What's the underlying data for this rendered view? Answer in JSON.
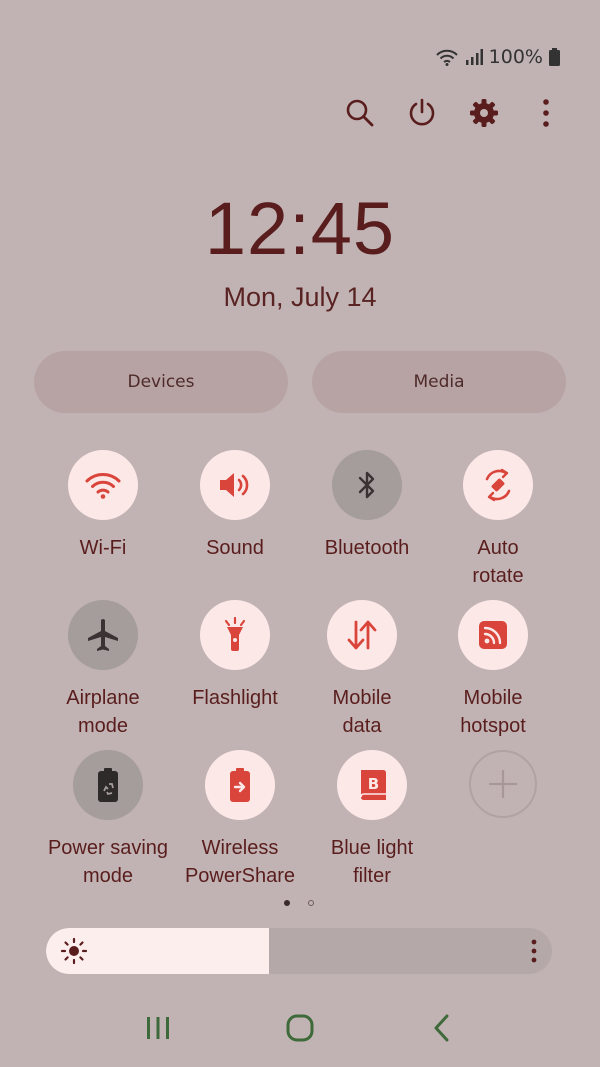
{
  "status": {
    "battery_text": "100%",
    "icons": [
      "wifi-icon",
      "signal-icon",
      "battery-icon"
    ]
  },
  "top_actions": [
    "search-icon",
    "power-icon",
    "settings-icon",
    "more-icon"
  ],
  "clock": {
    "time": "12:45",
    "date": "Mon, July 14"
  },
  "pills": {
    "devices": "Devices",
    "media": "Media"
  },
  "tiles": {
    "wifi": {
      "label": "Wi-Fi",
      "on": true
    },
    "sound": {
      "label": "Sound",
      "on": true
    },
    "bluetooth": {
      "label": "Bluetooth",
      "on": false
    },
    "auto_rotate": {
      "label_1": "Auto",
      "label_2": "rotate",
      "on": true
    },
    "airplane": {
      "label_1": "Airplane",
      "label_2": "mode",
      "on": false
    },
    "flashlight": {
      "label": "Flashlight",
      "on": true
    },
    "mobile_data": {
      "label_1": "Mobile",
      "label_2": "data",
      "on": true
    },
    "hotspot": {
      "label_1": "Mobile",
      "label_2": "hotspot",
      "on": true
    },
    "power_saving": {
      "label_1": "Power saving",
      "label_2": "mode",
      "on": false
    },
    "powershare": {
      "label_1": "Wireless",
      "label_2": "PowerShare",
      "on": true
    },
    "blue_light": {
      "label_1": "Blue light",
      "label_2": "filter",
      "on": true
    }
  },
  "pager": {
    "pages": 2,
    "current": 1
  },
  "brightness": {
    "level": 0.44
  },
  "colors": {
    "background": "#c1b3b3",
    "accent": "#d9443b",
    "tile_on": "#fde8e8",
    "tile_off": "#a59c9c",
    "text": "#5a1d1d"
  }
}
